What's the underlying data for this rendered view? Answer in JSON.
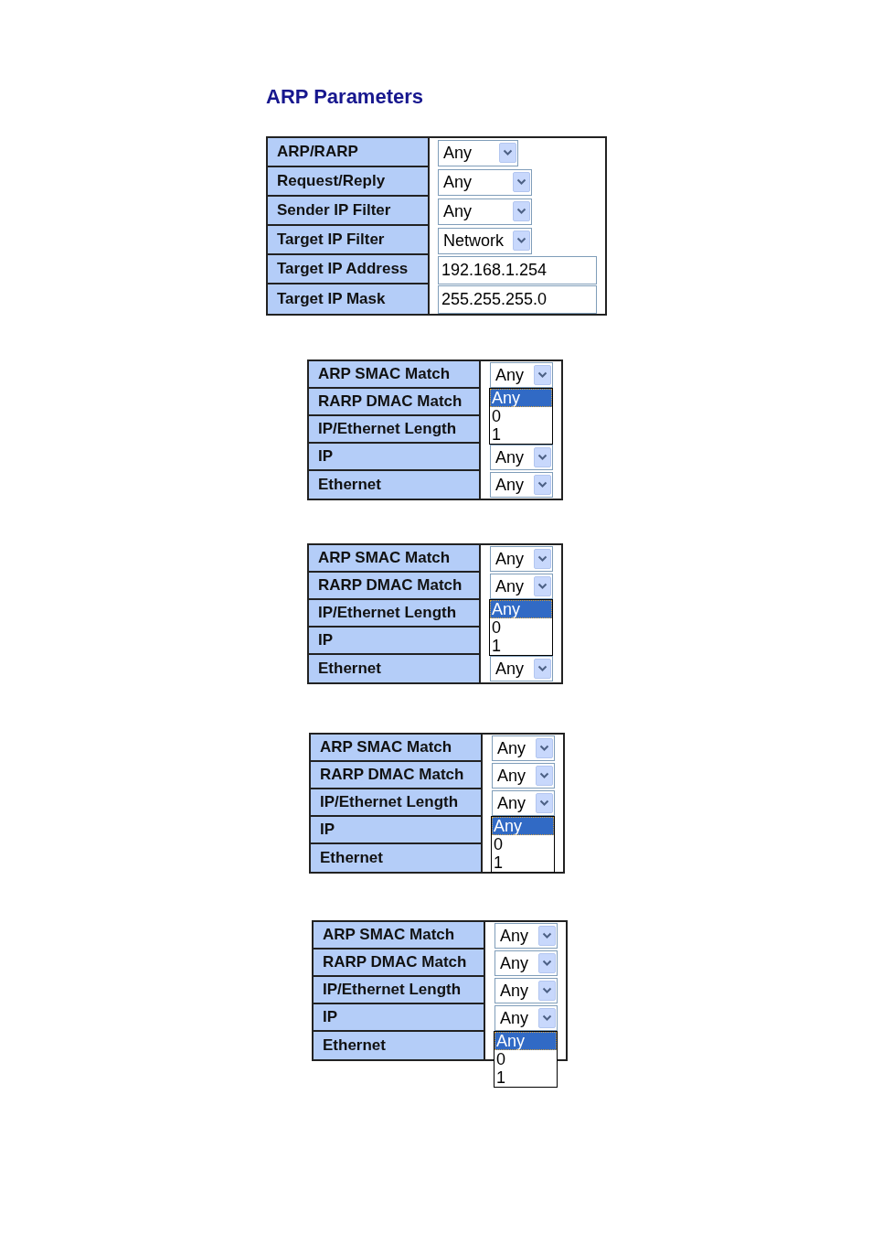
{
  "title": "ARP Parameters",
  "tables": [
    {
      "rows": [
        {
          "label": "ARP/RARP",
          "kind": "select",
          "value": "Any"
        },
        {
          "label": "Request/Reply",
          "kind": "select",
          "value": "Any"
        },
        {
          "label": "Sender IP Filter",
          "kind": "select",
          "value": "Any"
        },
        {
          "label": "Target IP Filter",
          "kind": "select",
          "value": "Network"
        },
        {
          "label": "Target IP Address",
          "kind": "text",
          "value": "192.168.1.254"
        },
        {
          "label": "Target IP Mask",
          "kind": "text",
          "value": "255.255.255.0"
        }
      ]
    },
    {
      "rows": [
        {
          "label": "ARP SMAC Match",
          "kind": "select",
          "value": "Any",
          "options": [
            {
              "label": "Any",
              "selected": true
            },
            {
              "label": "0",
              "selected": false
            },
            {
              "label": "1",
              "selected": false
            }
          ]
        },
        {
          "label": "RARP DMAC Match",
          "kind": "label"
        },
        {
          "label": "IP/Ethernet Length",
          "kind": "label"
        },
        {
          "label": "IP",
          "kind": "select",
          "value": "Any"
        },
        {
          "label": "Ethernet",
          "kind": "select",
          "value": "Any"
        }
      ]
    },
    {
      "rows": [
        {
          "label": "ARP SMAC Match",
          "kind": "select",
          "value": "Any"
        },
        {
          "label": "RARP DMAC Match",
          "kind": "select",
          "value": "Any",
          "options": [
            {
              "label": "Any",
              "selected": true
            },
            {
              "label": "0",
              "selected": false
            },
            {
              "label": "1",
              "selected": false
            }
          ]
        },
        {
          "label": "IP/Ethernet Length",
          "kind": "label"
        },
        {
          "label": "IP",
          "kind": "label"
        },
        {
          "label": "Ethernet",
          "kind": "select",
          "value": "Any"
        }
      ]
    },
    {
      "rows": [
        {
          "label": "ARP SMAC Match",
          "kind": "select",
          "value": "Any"
        },
        {
          "label": "RARP DMAC Match",
          "kind": "select",
          "value": "Any"
        },
        {
          "label": "IP/Ethernet Length",
          "kind": "select",
          "value": "Any",
          "options": [
            {
              "label": "Any",
              "selected": true
            },
            {
              "label": "0",
              "selected": false
            },
            {
              "label": "1",
              "selected": false
            }
          ]
        },
        {
          "label": "IP",
          "kind": "label"
        },
        {
          "label": "Ethernet",
          "kind": "label"
        }
      ]
    },
    {
      "rows": [
        {
          "label": "ARP SMAC Match",
          "kind": "select",
          "value": "Any"
        },
        {
          "label": "RARP DMAC Match",
          "kind": "select",
          "value": "Any"
        },
        {
          "label": "IP/Ethernet Length",
          "kind": "select",
          "value": "Any"
        },
        {
          "label": "IP",
          "kind": "select",
          "value": "Any",
          "options": [
            {
              "label": "Any",
              "selected": true
            },
            {
              "label": "0",
              "selected": false
            },
            {
              "label": "1",
              "selected": false
            }
          ]
        },
        {
          "label": "Ethernet",
          "kind": "label"
        }
      ]
    }
  ]
}
